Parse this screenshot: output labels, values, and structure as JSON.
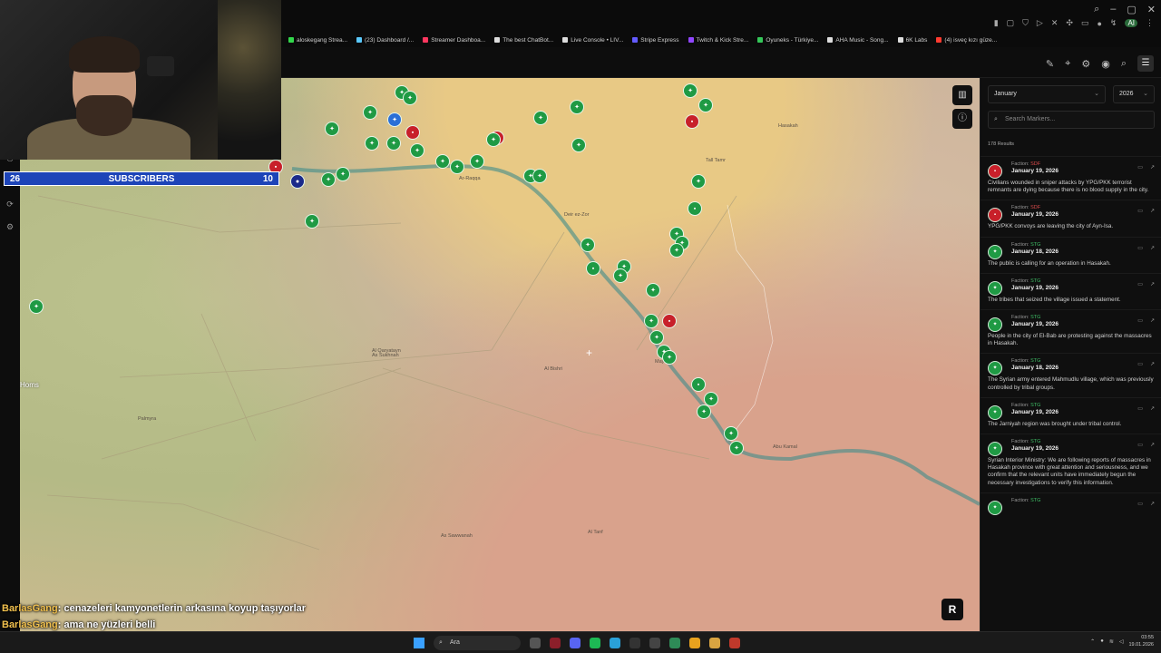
{
  "browser": {
    "window_controls": [
      "⌕",
      "–",
      "▢",
      "✕"
    ],
    "extensions_ai": "AI",
    "bookmarks": [
      {
        "label": "aloskegang Strea...",
        "color": "#32d74b"
      },
      {
        "label": "(23) Dashboard /...",
        "color": "#5ac8fa"
      },
      {
        "label": "Streamer Dashboa...",
        "color": "#ff375f"
      },
      {
        "label": "The best ChatBot...",
        "color": "#dddddd"
      },
      {
        "label": "Live Console • LIV...",
        "color": "#dddddd"
      },
      {
        "label": "Stripe Express",
        "color": "#635bff"
      },
      {
        "label": "Twitch & Kick Stre...",
        "color": "#9146ff"
      },
      {
        "label": "Oyuneks - Türkiye...",
        "color": "#34c759"
      },
      {
        "label": "AHA Music - Song...",
        "color": "#dddddd"
      },
      {
        "label": "6K Labs",
        "color": "#dddddd"
      },
      {
        "label": "(4) isveç kızı güze...",
        "color": "#ff3b30"
      }
    ]
  },
  "header": {
    "icons": [
      "pen-icon",
      "pin-icon",
      "gear-icon",
      "camera-icon",
      "search-icon",
      "menu-icon"
    ]
  },
  "webcam": {
    "subscribers_label": "SUBSCRIBERS",
    "subscribers_current": "26",
    "subscribers_goal": "10"
  },
  "map": {
    "places": [
      {
        "name": "Homs",
        "big": true
      },
      {
        "name": "Palmyra",
        "big": false
      },
      {
        "name": "Al Qaryatayn",
        "big": false
      },
      {
        "name": "As Sukhnah",
        "big": false
      },
      {
        "name": "Tall Tamr",
        "big": false
      },
      {
        "name": "Hasakah",
        "big": false
      },
      {
        "name": "Deir ez-Zor",
        "big": false
      },
      {
        "name": "Mayadin",
        "big": false
      },
      {
        "name": "Abu Kamal",
        "big": false
      },
      {
        "name": "Ar-Raqqa",
        "big": false
      },
      {
        "name": "As Sawwanah",
        "big": false
      },
      {
        "name": "Al Bishri",
        "big": false
      },
      {
        "name": "Al Tanf",
        "big": false
      }
    ],
    "brand_logo": "R"
  },
  "panel": {
    "month": "January",
    "year": "2026",
    "search_placeholder": "Search Markers...",
    "results_count": "178 Results",
    "faction_prefix": "Faction:",
    "items": [
      {
        "faction": "SDF",
        "date": "January 19, 2026",
        "text": "Civilians wounded in sniper attacks by YPG/PKK terrorist remnants are dying because there is no blood supply in the city."
      },
      {
        "faction": "SDF",
        "date": "January 19, 2026",
        "text": "YPG/PKK convoys are leaving the city of Ayn-Isa."
      },
      {
        "faction": "STG",
        "date": "January 18, 2026",
        "text": "The public is calling for an operation in Hasakah."
      },
      {
        "faction": "STG",
        "date": "January 19, 2026",
        "text": "The tribes that seized the village issued a statement."
      },
      {
        "faction": "STG",
        "date": "January 19, 2026",
        "text": "People in the city of El-Bab are protesting against the massacres in Hasakah."
      },
      {
        "faction": "STG",
        "date": "January 18, 2026",
        "text": "The Syrian army entered Mahmudlu village, which was previously controlled by tribal groups."
      },
      {
        "faction": "STG",
        "date": "January 19, 2026",
        "text": "The Jarniyah region was brought under tribal control."
      },
      {
        "faction": "STG",
        "date": "January 19, 2026",
        "text": "Syrian Interior Ministry: We are following reports of massacres in Hasakah province with great attention and seriousness, and we confirm that the relevant units have immediately begun the necessary investigations to verify this information."
      },
      {
        "faction": "STG",
        "date": "",
        "text": ""
      }
    ]
  },
  "chat": [
    {
      "user": "BarlasGang",
      "message": ": cenazeleri kamyonetlerin arkasına koyup taşıyorlar"
    },
    {
      "user": "BarlasGang",
      "message": ": ama ne yüzleri belli"
    }
  ],
  "taskbar": {
    "search_label": "Ara",
    "time": "03:55",
    "date": "19.01.2026"
  }
}
